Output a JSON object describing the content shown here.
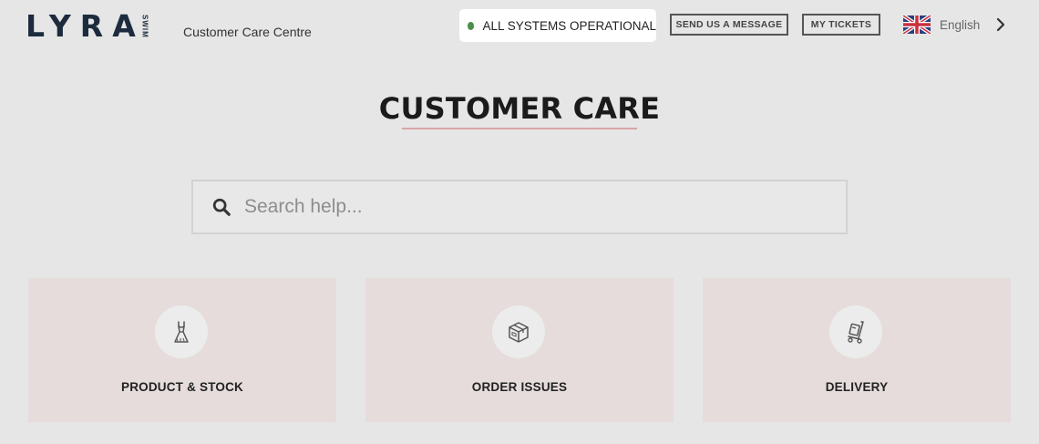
{
  "header": {
    "logo_text": "LYRA",
    "logo_tag": "SWIM",
    "subtitle": "Customer Care Centre",
    "status": {
      "text": "ALL SYSTEMS OPERATIONAL",
      "dot_color": "#4a8f4a"
    },
    "send_message_label": "SEND US A MESSAGE",
    "my_tickets_label": "MY TICKETS",
    "language": {
      "label": "English",
      "flag_icon": "uk-flag-icon"
    }
  },
  "page": {
    "title": "CUSTOMER CARE",
    "accent_color": "#d9a6a8"
  },
  "search": {
    "placeholder": "Search help...",
    "value": ""
  },
  "categories": [
    {
      "label": "PRODUCT & STOCK",
      "icon": "dress-icon"
    },
    {
      "label": "ORDER ISSUES",
      "icon": "box-icon"
    },
    {
      "label": "DELIVERY",
      "icon": "hand-truck-icon"
    }
  ],
  "colors": {
    "background": "#e6e6e6",
    "card_background": "#e6dcdc",
    "logo": "#1c2b3d"
  }
}
